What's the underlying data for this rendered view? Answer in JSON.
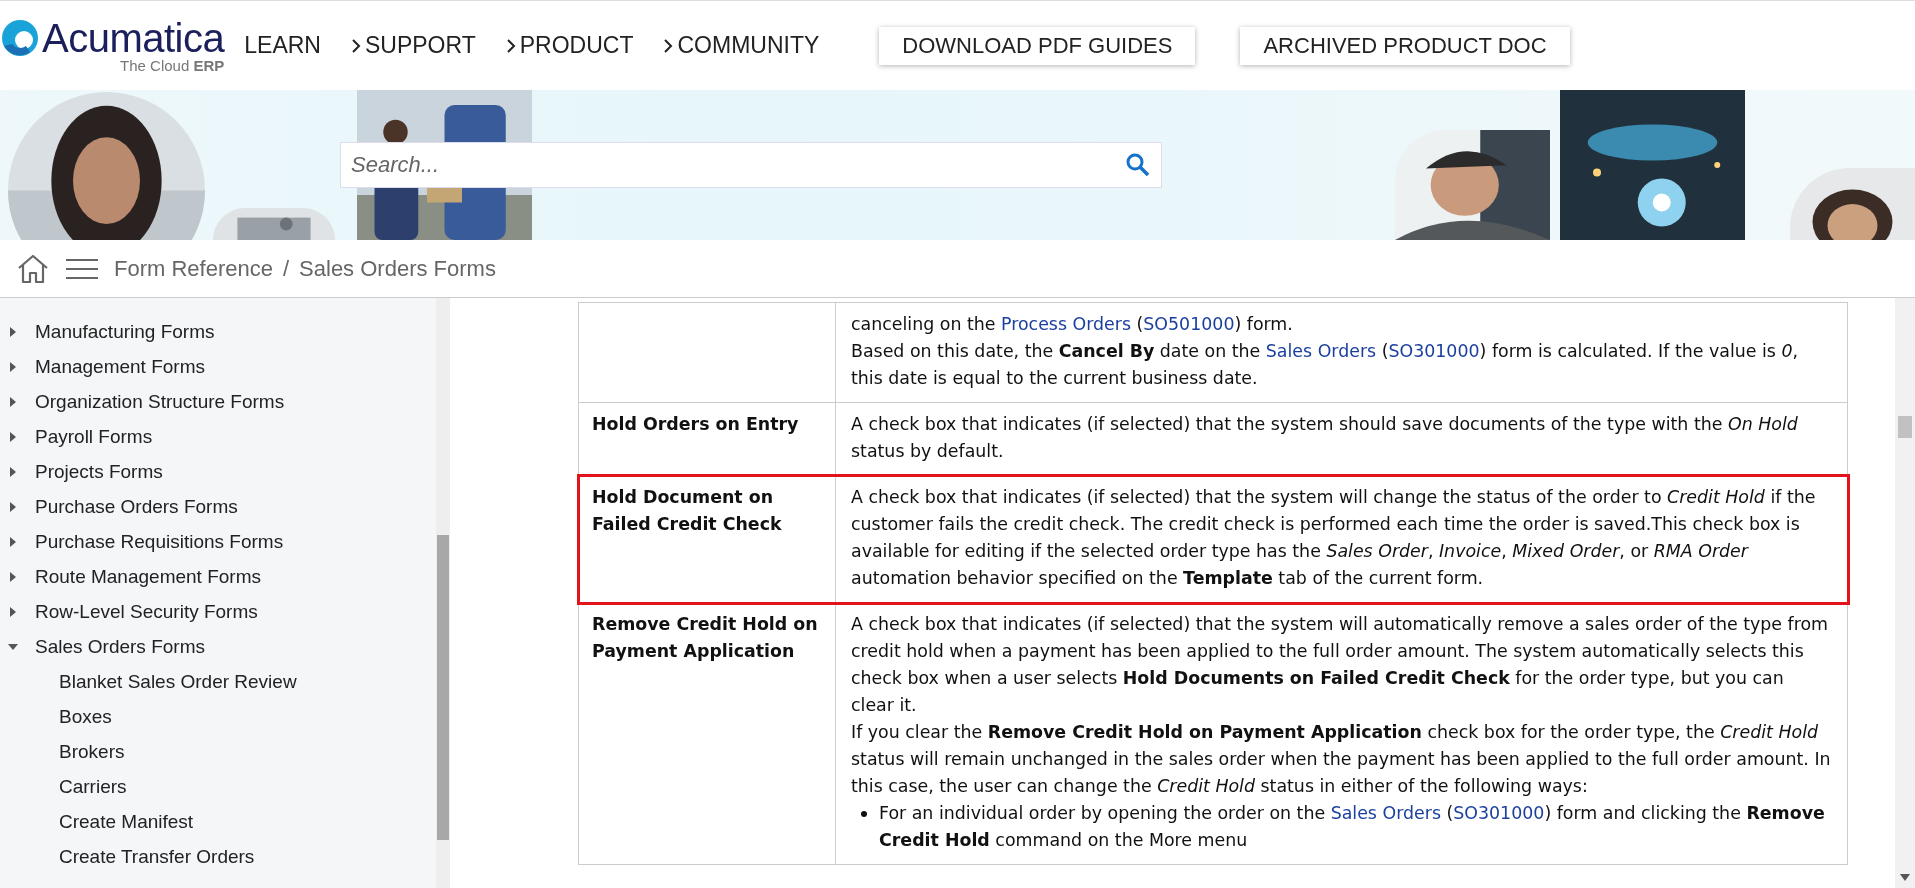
{
  "header": {
    "logo": {
      "name": "Acumatica",
      "tagline": "The Cloud **ERP**"
    },
    "nav": [
      {
        "label": "LEARN",
        "kind": "plain"
      },
      {
        "label": "SUPPORT",
        "kind": "chevron"
      },
      {
        "label": "PRODUCT",
        "kind": "chevron"
      },
      {
        "label": "COMMUNITY",
        "kind": "chevron"
      }
    ],
    "buttons": [
      "DOWNLOAD PDF GUIDES",
      "ARCHIVED PRODUCT DOC"
    ]
  },
  "banner": {
    "search": {
      "placeholder": "Search..."
    }
  },
  "breadcrumb": {
    "items": [
      "Form Reference",
      "Sales Orders Forms"
    ],
    "separator": "/"
  },
  "sidebar": {
    "items": [
      {
        "label": "Manufacturing Forms",
        "expanded": false
      },
      {
        "label": "Management Forms",
        "expanded": false
      },
      {
        "label": "Organization Structure Forms",
        "expanded": false
      },
      {
        "label": "Payroll Forms",
        "expanded": false
      },
      {
        "label": "Projects Forms",
        "expanded": false
      },
      {
        "label": "Purchase Orders Forms",
        "expanded": false
      },
      {
        "label": "Purchase Requisitions Forms",
        "expanded": false
      },
      {
        "label": "Route Management Forms",
        "expanded": false
      },
      {
        "label": "Row-Level Security Forms",
        "expanded": false
      },
      {
        "label": "Sales Orders Forms",
        "expanded": true,
        "children": [
          {
            "label": "Blanket Sales Order Review"
          },
          {
            "label": "Boxes"
          },
          {
            "label": "Brokers"
          },
          {
            "label": "Carriers"
          },
          {
            "label": "Create Manifest"
          },
          {
            "label": "Create Transfer Orders"
          }
        ]
      }
    ]
  },
  "table": {
    "rows": [
      {
        "highlighted": false,
        "description": [
          {
            "kind": "para",
            "segments": [
              {
                "kind": "text",
                "text": "canceling on the "
              },
              {
                "kind": "link",
                "text": "Process Orders"
              },
              {
                "kind": "text",
                "text": " ("
              },
              {
                "kind": "link",
                "text": "SO501000"
              },
              {
                "kind": "text",
                "text": ") form."
              }
            ]
          },
          {
            "kind": "para",
            "segments": [
              {
                "kind": "text",
                "text": "Based on this date, the **Cancel By** date on the "
              },
              {
                "kind": "link",
                "text": "Sales Orders"
              },
              {
                "kind": "text",
                "text": " ("
              },
              {
                "kind": "link",
                "text": "SO301000"
              },
              {
                "kind": "text",
                "text": ") form is calculated. If the value is *0*, this date is equal to the current business date."
              }
            ]
          }
        ]
      },
      {
        "field": "Hold Orders on Entry",
        "highlighted": false,
        "description": [
          {
            "kind": "para",
            "segments": [
              {
                "kind": "text",
                "text": "A check box that indicates (if selected) that the system should save documents of the type with the *On Hold* status by default."
              }
            ]
          }
        ]
      },
      {
        "field": "Hold Document on Failed Credit Check",
        "highlighted": true,
        "description": [
          {
            "kind": "para",
            "segments": [
              {
                "kind": "text",
                "text": "A check box that indicates (if selected) that the system will change the status of the order to *Credit Hold* if the customer fails the credit check. The credit check is performed each time the order is saved.This check box is available for editing if the selected order type has the *Sales Order*, *Invoice*, *Mixed Order*, or *RMA Order* automation behavior specified on the **Template** tab of the current form."
              }
            ]
          }
        ]
      },
      {
        "field": "Remove Credit Hold on Payment Application",
        "highlighted": false,
        "description": [
          {
            "kind": "para",
            "segments": [
              {
                "kind": "text",
                "text": "A check box that indicates (if selected) that the system will automatically remove a sales order of the type from credit hold when a payment has been applied to the full order amount. The system automatically selects this check box when a user selects **Hold Documents on Failed Credit Check** for the order type, but you can clear it."
              }
            ]
          },
          {
            "kind": "para",
            "segments": [
              {
                "kind": "text",
                "text": "If you clear the **Remove Credit Hold on Payment Application** check box for the order type, the *Credit Hold* status will remain unchanged in the sales order when the payment has been applied to the full order amount. In this case, the user can change the *Credit Hold* status in either of the following ways:"
              }
            ]
          },
          {
            "kind": "bullet",
            "segments": [
              {
                "kind": "text",
                "text": "For an individual order by opening the order on the "
              },
              {
                "kind": "link",
                "text": "Sales Orders"
              },
              {
                "kind": "text",
                "text": " ("
              },
              {
                "kind": "link",
                "text": "SO301000"
              },
              {
                "kind": "text",
                "text": ") form and clicking the **Remove Credit Hold** command on the More menu"
              }
            ]
          }
        ]
      }
    ]
  }
}
